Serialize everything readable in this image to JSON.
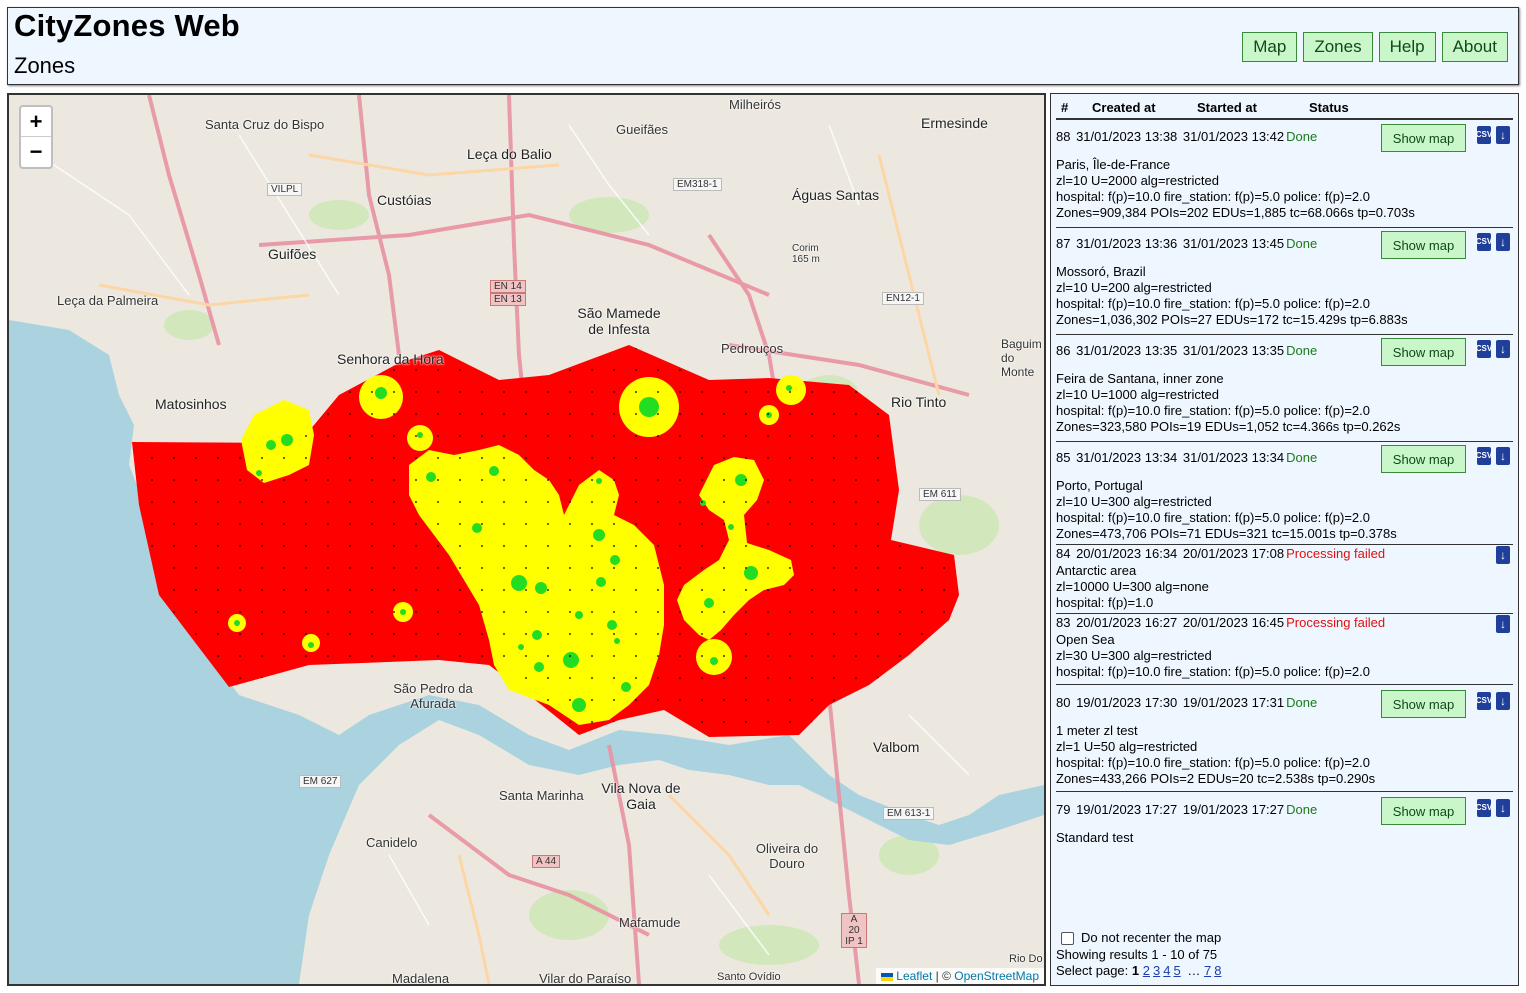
{
  "header": {
    "title": "CityZones Web",
    "subtitle": "Zones",
    "nav": [
      "Map",
      "Zones",
      "Help",
      "About"
    ]
  },
  "map": {
    "zoom_in": "+",
    "zoom_out": "−",
    "attribution": {
      "leaflet": "Leaflet",
      "sep": " | © ",
      "osm": "OpenStreetMap"
    },
    "labels": [
      "Santa Cruz do Bispo",
      "Milheirós",
      "Gueifães",
      "Ermesinde",
      "Leça do Balio",
      "Custóias",
      "Águas Santas",
      "Guifões",
      "Leça da Palmeira",
      "São Mamede de Infesta",
      "Senhora da Hora",
      "Matosinhos",
      "Pedrouços",
      "Rio Tinto",
      "São Pedro da Afurada",
      "Santa Marinha",
      "Vila Nova de Gaia",
      "Valbom",
      "Canidelo",
      "Oliveira do Douro",
      "Mafamude",
      "Madalena",
      "Vilar do Paraíso",
      "Santo Ovídio",
      "Rio Do",
      "Baguim do Monte",
      "Corim 165 m"
    ],
    "road_tags": [
      "VILPL",
      "EM318-1",
      "EN 14",
      "EN 13",
      "EN12-1",
      "EM 611",
      "EM 627",
      "A 44",
      "EM 613-1",
      "A 20 IP 1"
    ],
    "zone_colors": {
      "uncovered": "#ff0000",
      "partial": "#ffff00",
      "covered": "#00dd00"
    }
  },
  "table": {
    "headers": {
      "num": "#",
      "created": "Created at",
      "started": "Started at",
      "status": "Status"
    },
    "show_map_label": "Show map",
    "csv_label": "CSV",
    "jobs": [
      {
        "id": "88",
        "created": "31/01/2023 13:38",
        "started": "31/01/2023 13:42",
        "status": "Done",
        "show_map": true,
        "name": "Paris, Île-de-France",
        "params": "zl=10   U=2000   alg=restricted",
        "weights": "hospital: f(p)=10.0   fire_station: f(p)=5.0   police: f(p)=2.0",
        "stats": "Zones=909,384   POIs=202   EDUs=1,885   tc=68.066s   tp=0.703s"
      },
      {
        "id": "87",
        "created": "31/01/2023 13:36",
        "started": "31/01/2023 13:45",
        "status": "Done",
        "show_map": true,
        "name": "Mossoró, Brazil",
        "params": "zl=10   U=200   alg=restricted",
        "weights": "hospital: f(p)=10.0   fire_station: f(p)=5.0   police: f(p)=2.0",
        "stats": "Zones=1,036,302   POIs=27   EDUs=172   tc=15.429s   tp=6.883s"
      },
      {
        "id": "86",
        "created": "31/01/2023 13:35",
        "started": "31/01/2023 13:35",
        "status": "Done",
        "show_map": true,
        "name": "Feira de Santana, inner zone",
        "params": "zl=10   U=1000   alg=restricted",
        "weights": "hospital: f(p)=10.0   fire_station: f(p)=5.0   police: f(p)=2.0",
        "stats": "Zones=323,580   POIs=19   EDUs=1,052   tc=4.366s   tp=0.262s"
      },
      {
        "id": "85",
        "created": "31/01/2023 13:34",
        "started": "31/01/2023 13:34",
        "status": "Done",
        "show_map": true,
        "name": "Porto, Portugal",
        "params": "zl=10   U=300   alg=restricted",
        "weights": "hospital: f(p)=10.0   fire_station: f(p)=5.0   police: f(p)=2.0",
        "stats": "Zones=473,706   POIs=71   EDUs=321   tc=15.001s   tp=0.378s"
      },
      {
        "id": "84",
        "created": "20/01/2023 16:34",
        "started": "20/01/2023 17:08",
        "status": "Processing failed",
        "show_map": false,
        "name": "Antarctic area",
        "params": "zl=10000   U=300   alg=none",
        "weights": "hospital: f(p)=1.0",
        "stats": ""
      },
      {
        "id": "83",
        "created": "20/01/2023 16:27",
        "started": "20/01/2023 16:45",
        "status": "Processing failed",
        "show_map": false,
        "name": "Open Sea",
        "params": "zl=30   U=300   alg=restricted",
        "weights": "hospital: f(p)=10.0   fire_station: f(p)=5.0   police: f(p)=2.0",
        "stats": ""
      },
      {
        "id": "80",
        "created": "19/01/2023 17:30",
        "started": "19/01/2023 17:31",
        "status": "Done",
        "show_map": true,
        "name": "1 meter zl test",
        "params": "zl=1   U=50   alg=restricted",
        "weights": "hospital: f(p)=10.0   fire_station: f(p)=5.0   police: f(p)=2.0",
        "stats": "Zones=433,266   POIs=2   EDUs=20   tc=2.538s   tp=0.290s"
      },
      {
        "id": "79",
        "created": "19/01/2023 17:27",
        "started": "19/01/2023 17:27",
        "status": "Done",
        "show_map": true,
        "name": "Standard test",
        "params": "",
        "weights": "",
        "stats": ""
      }
    ]
  },
  "footer": {
    "recenter_label": "Do not recenter the map",
    "results": "Showing results 1 - 10 of 75",
    "select_page": "Select page:",
    "current_page": "1",
    "pages": [
      "2",
      "3",
      "4",
      "5"
    ],
    "ellipsis": "…",
    "last_pages": [
      "7",
      "8"
    ]
  }
}
